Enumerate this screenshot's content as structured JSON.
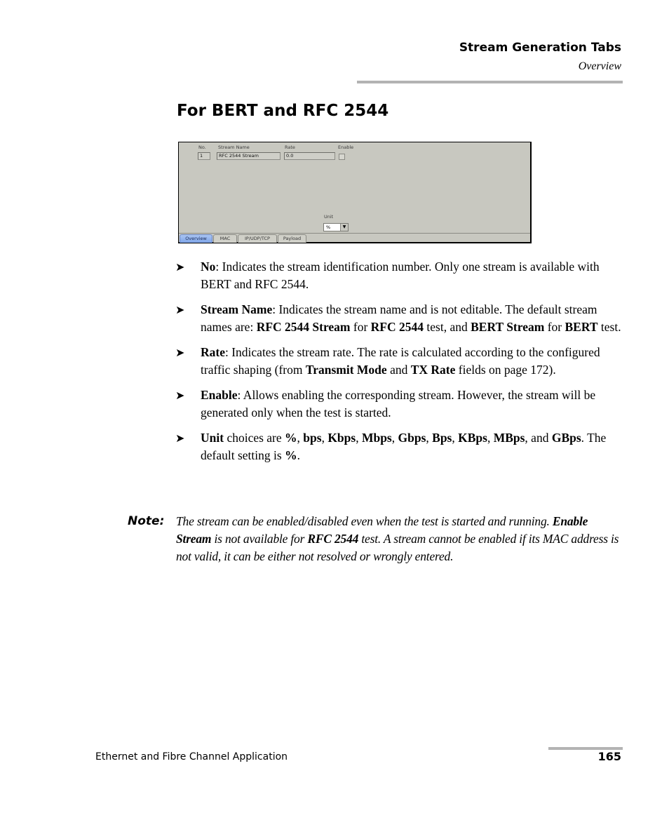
{
  "header": {
    "title": "Stream Generation Tabs",
    "subtitle": "Overview"
  },
  "section_title": "For BERT and RFC 2544",
  "app_screenshot": {
    "columns": {
      "no": "No.",
      "stream_name": "Stream Name",
      "rate": "Rate",
      "enable": "Enable"
    },
    "row": {
      "no": "1",
      "stream_name": "RFC 2544 Stream",
      "rate": "0.0",
      "enable": false
    },
    "unit_label": "Unit",
    "unit_value": "%",
    "dropdown_icon": "chevron-down-icon",
    "tabs": [
      {
        "label": "Overview",
        "active": true
      },
      {
        "label": "MAC",
        "active": false
      },
      {
        "label": "IP/UDP/TCP",
        "active": false
      },
      {
        "label": "Payload",
        "active": false
      }
    ]
  },
  "bullets": [
    {
      "term": "No",
      "p1": ": Indicates the stream identification number. Only one stream is available with BERT and RFC 2544."
    },
    {
      "term": "Stream Name",
      "p1": ": Indicates the stream name and is not editable. The default stream names are: ",
      "b1": "RFC 2544 Stream",
      "p2": " for ",
      "b2": "RFC 2544",
      "p3": " test, and ",
      "b3": "BERT Stream",
      "p4": " for ",
      "b4": "BERT",
      "p5": " test."
    },
    {
      "term": "Rate",
      "p1": ": Indicates the stream rate. The rate is calculated according to the configured traffic shaping (from ",
      "b1": "Transmit Mode",
      "p2": " and ",
      "b2": "TX Rate",
      "p3": " fields on page 172)."
    },
    {
      "term": "Enable",
      "p1": ": Allows enabling the corresponding stream. However, the stream will be generated only when the test is started."
    },
    {
      "term": "Unit",
      "p1": " choices are ",
      "units": [
        "%",
        "bps",
        "Kbps",
        "Mbps",
        "Gbps",
        "Bps",
        "KBps",
        "MBps",
        "GBps"
      ],
      "sep": ", ",
      "and": ", and ",
      "p2": ". The default setting is ",
      "b_default": "%",
      "p3": "."
    }
  ],
  "note": {
    "label": "Note:",
    "p1": "The stream can be enabled/disabled even when the test is started and running. ",
    "b1": "Enable Stream",
    "p2": " is not available for ",
    "b2": "RFC 2544",
    "p3": " test. A stream cannot be enabled if its MAC address is not valid, it can be either not resolved or wrongly entered."
  },
  "footer": {
    "left": "Ethernet and Fibre Channel Application",
    "page_number": "165"
  }
}
